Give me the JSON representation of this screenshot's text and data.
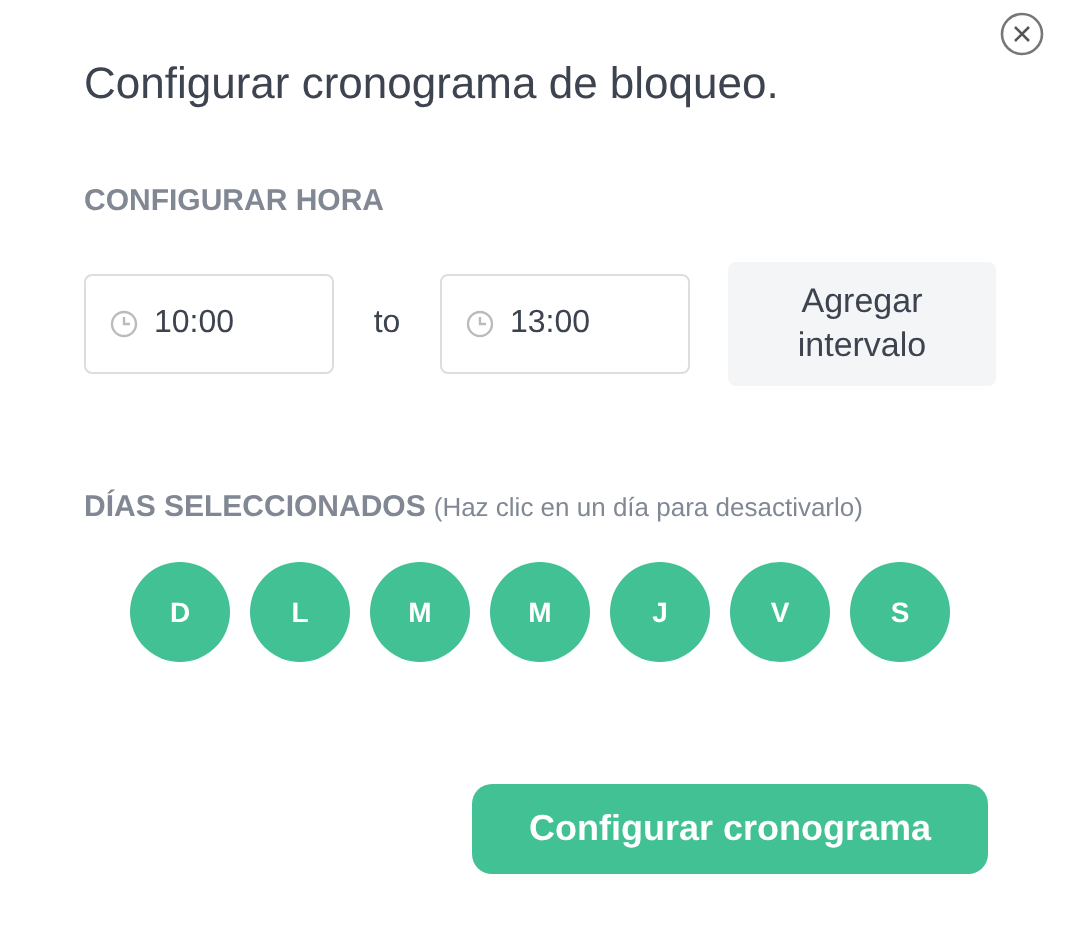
{
  "dialog": {
    "title": "Configurar cronograma de bloqueo.",
    "time_section": {
      "label": "CONFIGURAR HORA",
      "from": {
        "value": "10:00"
      },
      "separator": "to",
      "to": {
        "value": "13:00"
      },
      "add_button": "Agregar intervalo"
    },
    "days_section": {
      "label": "DÍAS SELECCIONADOS",
      "hint": "(Haz clic en un día para desactivarlo)",
      "days": [
        {
          "label": "D",
          "selected": true
        },
        {
          "label": "L",
          "selected": true
        },
        {
          "label": "M",
          "selected": true
        },
        {
          "label": "M",
          "selected": true
        },
        {
          "label": "J",
          "selected": true
        },
        {
          "label": "V",
          "selected": true
        },
        {
          "label": "S",
          "selected": true
        }
      ]
    },
    "submit_button": "Configurar cronograma"
  }
}
